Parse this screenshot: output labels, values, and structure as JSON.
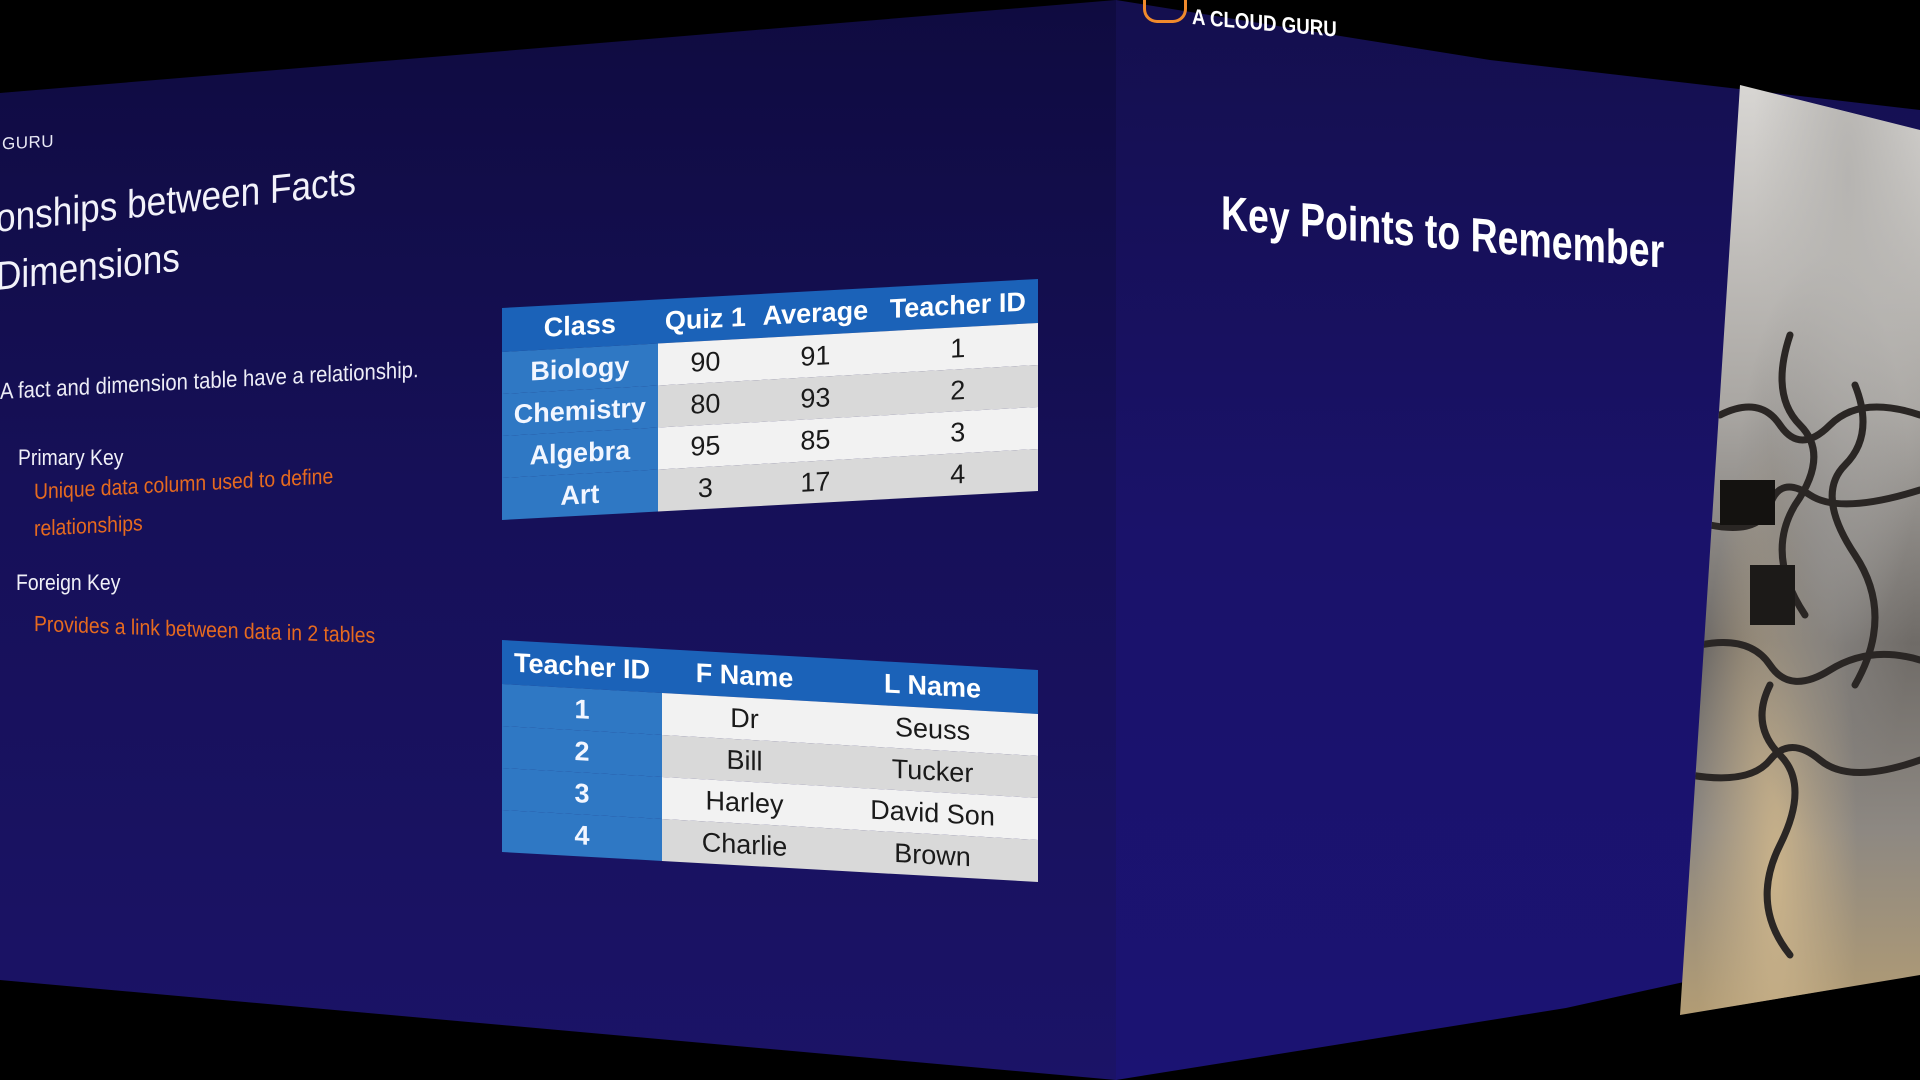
{
  "left_slide": {
    "brand": "GURU",
    "title_line1": "onships between Facts",
    "title_line2": "Dimensions",
    "intro": "A fact and dimension table have a relationship.",
    "primary_key": {
      "heading": "Primary Key",
      "description_line1": "Unique data column used to define",
      "description_line2": "relationships"
    },
    "foreign_key": {
      "heading": "Foreign Key",
      "description": "Provides a link between data in 2 tables"
    },
    "class_table": {
      "headers": [
        "Class",
        "Quiz 1",
        "Average",
        "Teacher ID"
      ],
      "rows": [
        [
          "Biology",
          "90",
          "91",
          "1"
        ],
        [
          "Chemistry",
          "80",
          "93",
          "2"
        ],
        [
          "Algebra",
          "95",
          "85",
          "3"
        ],
        [
          "Art",
          "3",
          "17",
          "4"
        ]
      ]
    },
    "teacher_table": {
      "headers": [
        "Teacher ID",
        "F Name",
        "L Name"
      ],
      "rows": [
        [
          "1",
          "Dr",
          "Seuss"
        ],
        [
          "2",
          "Bill",
          "Tucker"
        ],
        [
          "3",
          "Harley",
          "David Son"
        ],
        [
          "4",
          "Charlie",
          "Brown"
        ]
      ]
    },
    "colors": {
      "accent": "#e66a1f",
      "table_header": "#1b62b8",
      "table_lead": "#2f78c4"
    }
  },
  "right_slide": {
    "logo_text": "A CLOUD GURU",
    "logo_icon": "cloud-logo-icon",
    "title": "Key Points to Remember",
    "image": "puzzle-pieces-image"
  }
}
